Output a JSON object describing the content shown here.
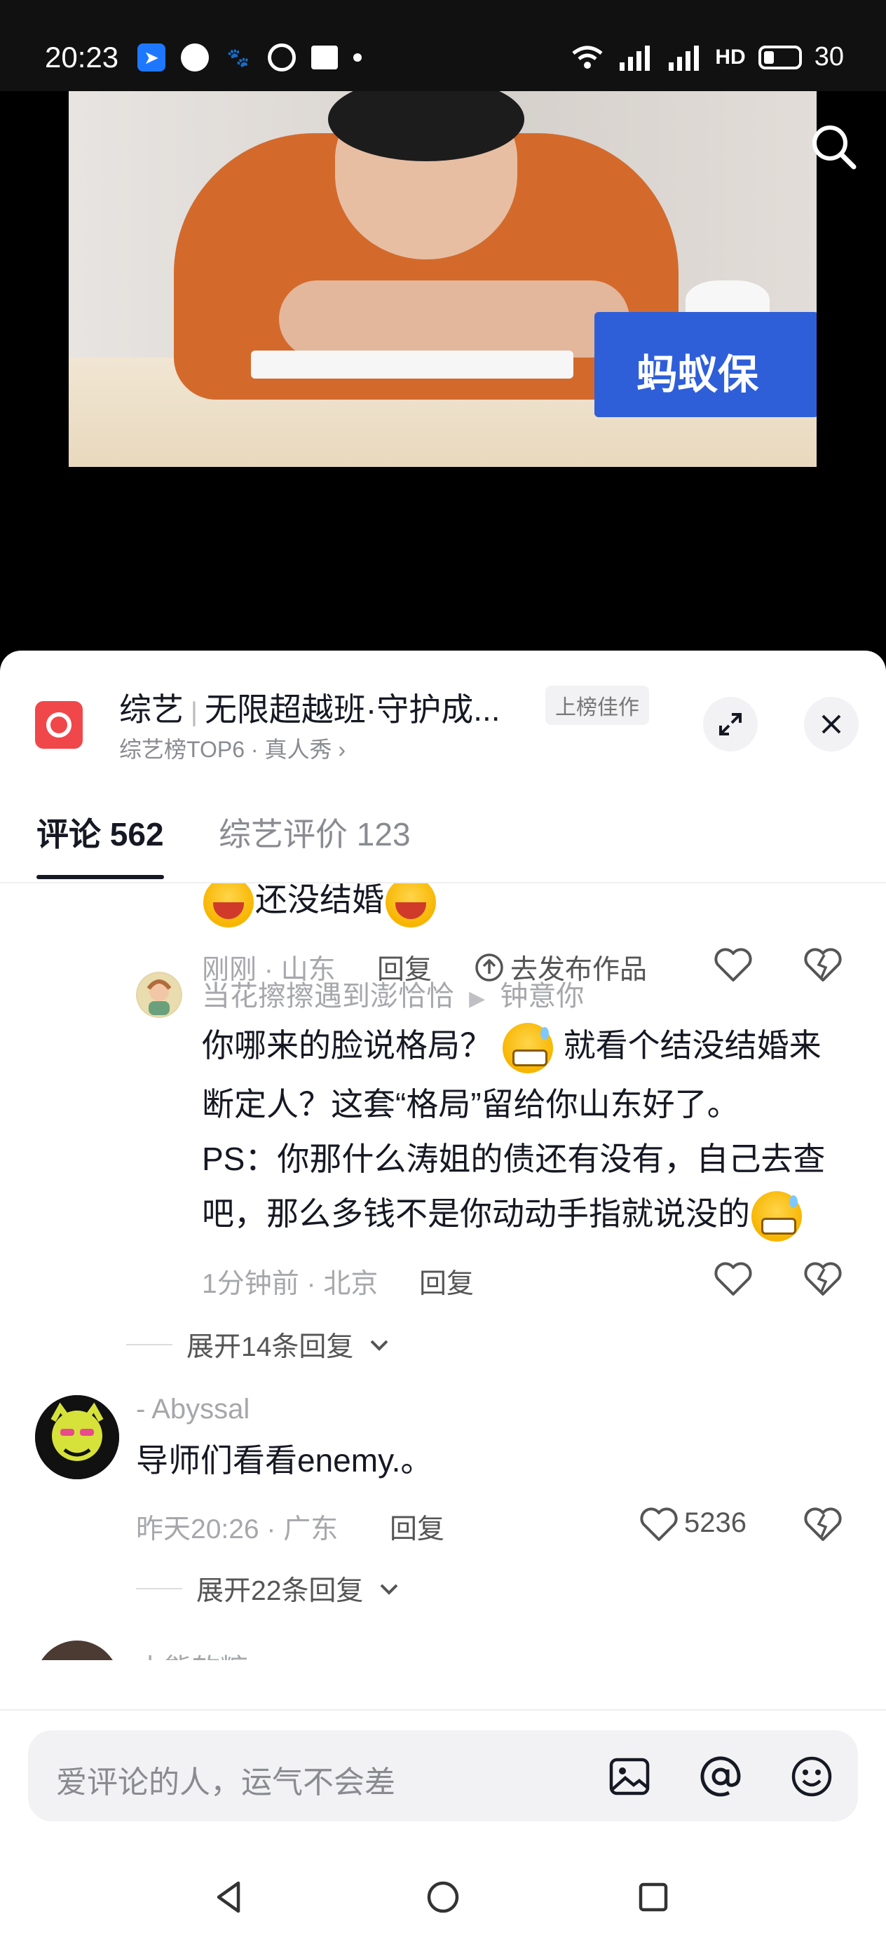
{
  "status_bar": {
    "time": "20:23",
    "network_label": "HD",
    "battery_level": "30"
  },
  "video": {
    "box_text": "蚂蚁保"
  },
  "header": {
    "category": "综艺",
    "title": "无限超越班·守护成...",
    "badge": "上榜佳作",
    "subtitle": "综艺榜TOP6 · 真人秀"
  },
  "tabs": [
    {
      "label": "评论 562"
    },
    {
      "label": "综艺评价 123"
    }
  ],
  "comments": {
    "partial": {
      "text": "还没结婚",
      "meta": "刚刚 · 山东",
      "reply": "回复",
      "publish": "去发布作品"
    },
    "reply1": {
      "user": "当花擦擦遇到澎恰恰",
      "reply_to": "钟意你",
      "line1a": "你哪来的脸说格局？",
      "line1b": "就看个结没结婚来",
      "line2": "断定人？这套“格局”留给你山东好了。",
      "line3": "PS：你那什么涛姐的债还有没有，自己去查",
      "line4": "吧，那么多钱不是你动动手指就说没的",
      "meta": "1分钟前 · 北京",
      "reply": "回复"
    },
    "expand1": "展开14条回复",
    "c2": {
      "user": "- Abyssal",
      "text": "导师们看看enemy.。",
      "meta": "昨天20:26 · 广东",
      "reply": "回复",
      "likes": "5236"
    },
    "expand2": "展开22条回复",
    "c3": {
      "user": "小熊软糖"
    }
  },
  "input": {
    "placeholder": "爱评论的人，运气不会差"
  },
  "colors": {
    "logo_red": "#f0474b",
    "video_box_blue": "#2f5fd8"
  }
}
